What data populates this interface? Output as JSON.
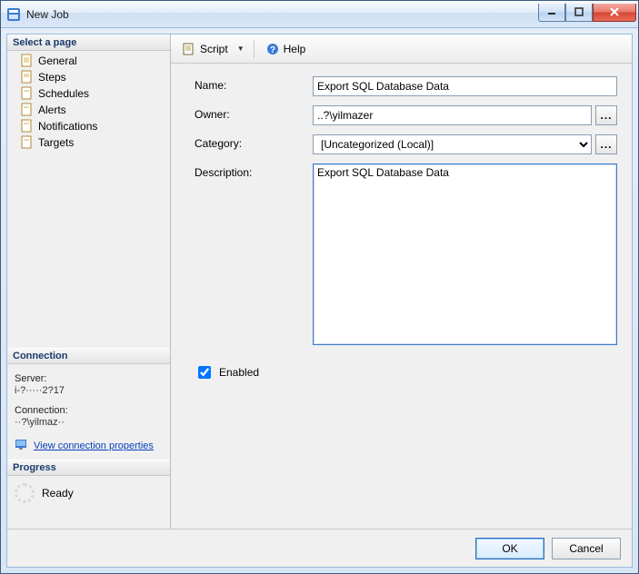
{
  "window": {
    "title": "New Job"
  },
  "sidebar": {
    "select_page_label": "Select a page",
    "pages": [
      {
        "label": "General"
      },
      {
        "label": "Steps"
      },
      {
        "label": "Schedules"
      },
      {
        "label": "Alerts"
      },
      {
        "label": "Notifications"
      },
      {
        "label": "Targets"
      }
    ],
    "connection_label": "Connection",
    "server_label": "Server:",
    "server_value": "i-?·····2?17",
    "conn_label": "Connection:",
    "conn_value": "··?\\yilmaz··",
    "view_conn_props": "View connection properties",
    "progress_label": "Progress",
    "progress_status": "Ready"
  },
  "toolbar": {
    "script_label": "Script",
    "help_label": "Help"
  },
  "form": {
    "name_label": "Name:",
    "name_value": "Export SQL Database Data",
    "owner_label": "Owner:",
    "owner_value": "..?\\yilmazer",
    "category_label": "Category:",
    "category_value": "[Uncategorized (Local)]",
    "description_label": "Description:",
    "description_value": "Export SQL Database Data",
    "enabled_label": "Enabled",
    "enabled_checked": true,
    "browse_glyph": "..."
  },
  "footer": {
    "ok_label": "OK",
    "cancel_label": "Cancel"
  }
}
